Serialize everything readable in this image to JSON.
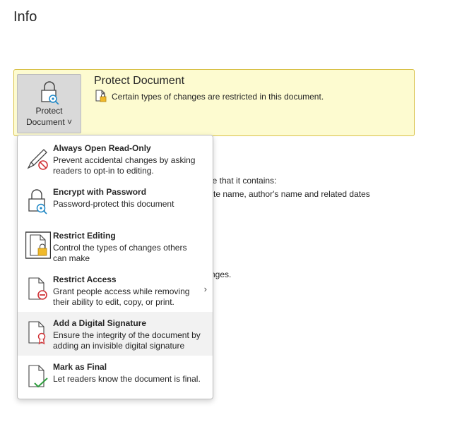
{
  "page": {
    "title": "Info"
  },
  "protect": {
    "button_line1": "Protect",
    "button_line2": "Document ˅",
    "title": "Protect Document",
    "description": "Certain types of changes are restricted in this document."
  },
  "background": {
    "line1": "are that it contains:",
    "line2": "plate name, author's name and related dates",
    "line3": "nges."
  },
  "menu": {
    "items": [
      {
        "title": "Always Open Read-Only",
        "desc": "Prevent accidental changes by asking readers to opt-in to editing.",
        "icon": "pencil-no-icon"
      },
      {
        "title": "Encrypt with Password",
        "desc": "Password-protect this document",
        "icon": "lock-key-icon"
      },
      {
        "title": "Restrict Editing",
        "desc": "Control the types of changes others can make",
        "icon": "document-lock-icon"
      },
      {
        "title": "Restrict Access",
        "desc": "Grant people access while removing their ability to edit, copy, or print.",
        "icon": "document-restrict-icon",
        "submenu": "›"
      },
      {
        "title": "Add a Digital Signature",
        "desc": "Ensure the integrity of the document by adding an invisible digital signature",
        "icon": "document-ribbon-icon"
      },
      {
        "title": "Mark as Final",
        "desc": "Let readers know the document is final.",
        "icon": "document-check-icon"
      }
    ]
  }
}
